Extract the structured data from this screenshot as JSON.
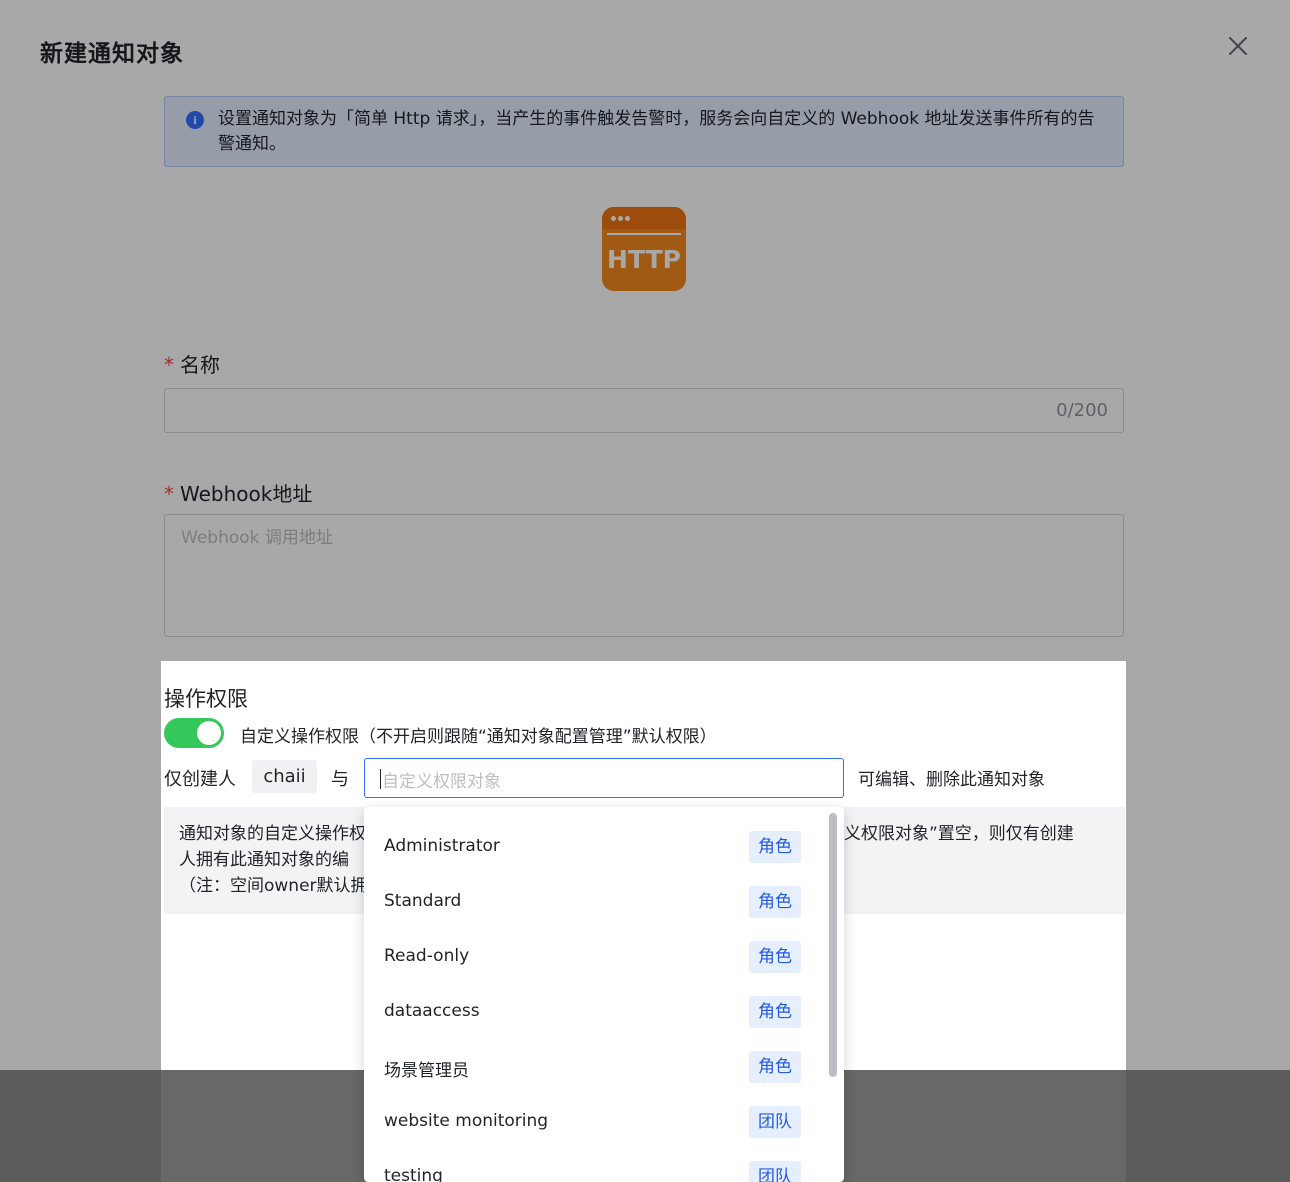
{
  "modal": {
    "title": "新建通知对象",
    "info_icon": "i",
    "info_text": "设置通知对象为「简单 Http 请求」，当产生的事件触发告警时，服务会向自定义的 Webhook 地址发送事件所有的告警通知。",
    "logo_text": "HTTP",
    "name_label": "名称",
    "required_mark": "*",
    "name_count": "0/200",
    "webhook_label": "Webhook地址",
    "webhook_placeholder": "Webhook 调用地址"
  },
  "permissions": {
    "title": "操作权限",
    "switch_on": true,
    "switch_text": "自定义操作权限（不开启则跟随“通知对象配置管理”默认权限）",
    "creator_label": "仅创建人",
    "creator_tag": "chaii",
    "and_text": "与",
    "select_placeholder": "自定义权限对象",
    "editable_text": "可编辑、删除此通知对象",
    "note_text": "通知对象的自定义操作权限，只对通知对象的编辑、删除生效。若开启自定义权限且将“自定义权限对象”置空，则仅有创建人拥有此通知对象的编辑、删除权限（注：空间owner默认拥有全部权限）。",
    "note_line1_left": "通知对象的自定义操作权",
    "note_line1_right": "义权限对象”置空，则仅有创建",
    "note_line2_left": "人拥有此通知对象的编",
    "note_line3_left": "（注：空间owner默认拥"
  },
  "dropdown": {
    "items": [
      {
        "name": "Administrator",
        "tag": "角色"
      },
      {
        "name": "Standard",
        "tag": "角色"
      },
      {
        "name": "Read-only",
        "tag": "角色"
      },
      {
        "name": "dataaccess",
        "tag": "角色"
      },
      {
        "name": "场景管理员",
        "tag": "角色"
      },
      {
        "name": "website monitoring",
        "tag": "团队"
      },
      {
        "name": "testing",
        "tag": "团队"
      }
    ]
  },
  "colors": {
    "accent": "#3370ff",
    "switch_on": "#34c759",
    "logo_orange": "#f5891f",
    "required": "#f54a45"
  }
}
